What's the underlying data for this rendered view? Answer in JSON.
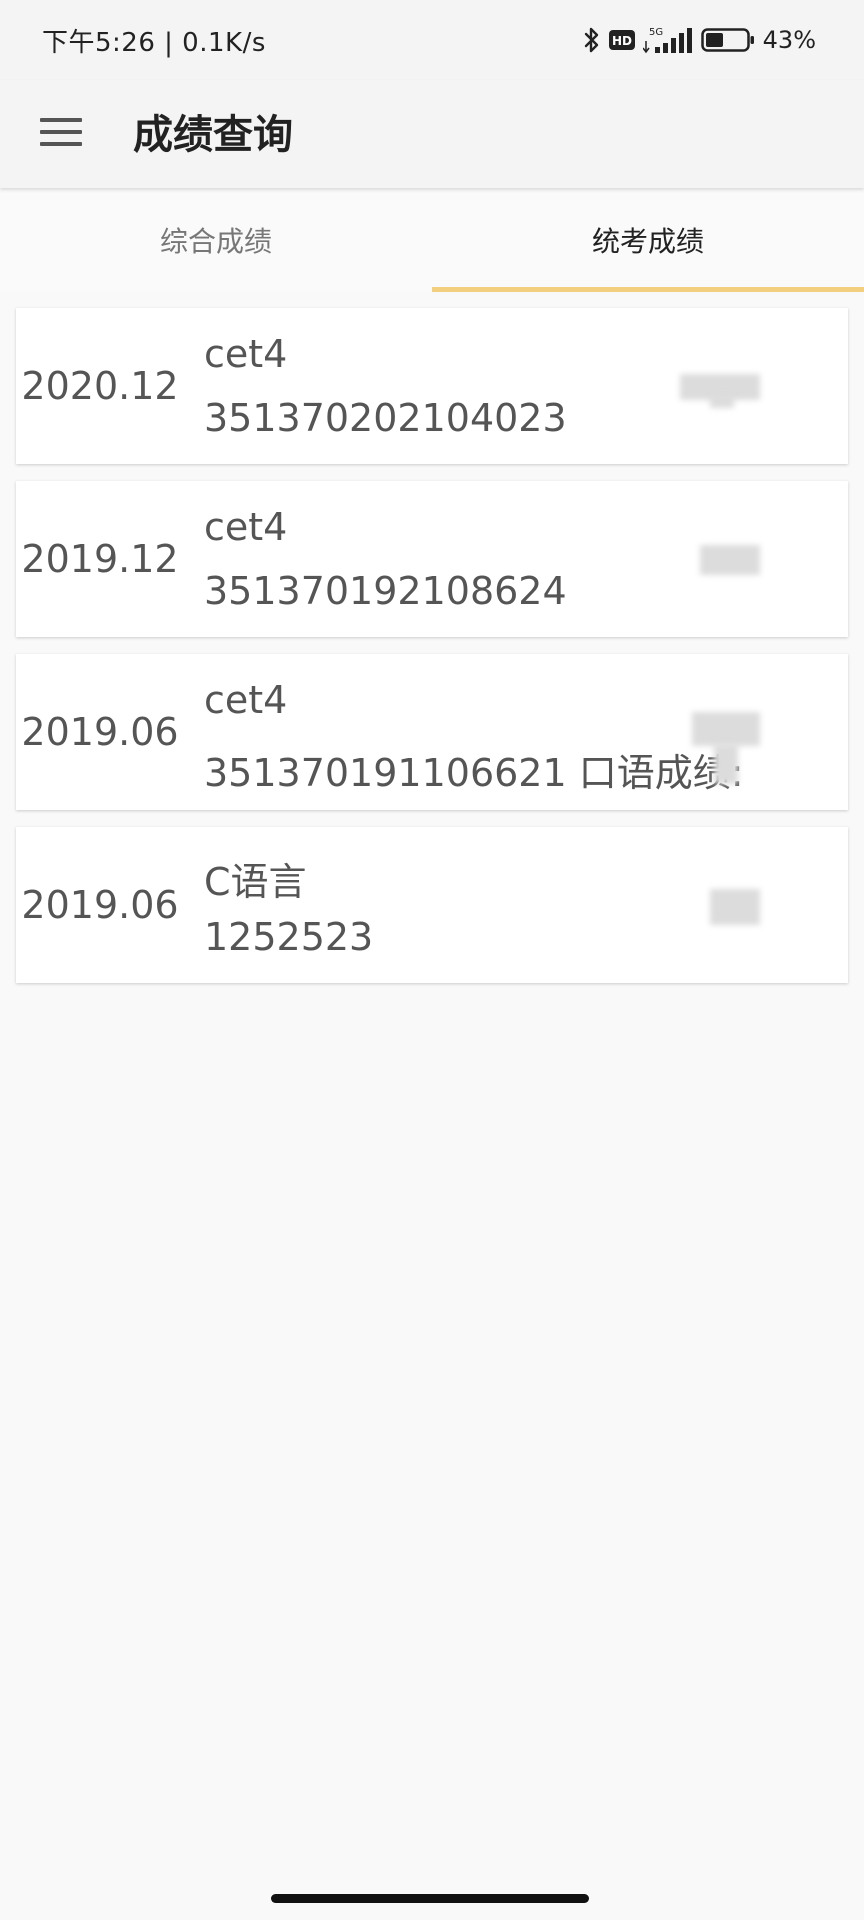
{
  "status_bar": {
    "time_speed": "下午5:26 | 0.1K/s",
    "hd_label": "HD",
    "network": "5G",
    "battery_percent": "43%",
    "battery_level": 0.43
  },
  "app_bar": {
    "title": "成绩查询"
  },
  "tabs": [
    {
      "label": "综合成绩",
      "active": false
    },
    {
      "label": "统考成绩",
      "active": true
    }
  ],
  "records": [
    {
      "date": "2020.12",
      "name": "cet4",
      "id_line": "351370202104023"
    },
    {
      "date": "2019.12",
      "name": "cet4",
      "id_line": "351370192108624"
    },
    {
      "date": "2019.06",
      "name": "cet4",
      "id_line": "351370191106621 口语成绩:"
    },
    {
      "date": "2019.06",
      "name": "C语言",
      "id_line": "1252523"
    }
  ],
  "colors": {
    "tab_indicator": "#f2cf7e",
    "background": "#f9f9f9",
    "card": "#ffffff"
  }
}
